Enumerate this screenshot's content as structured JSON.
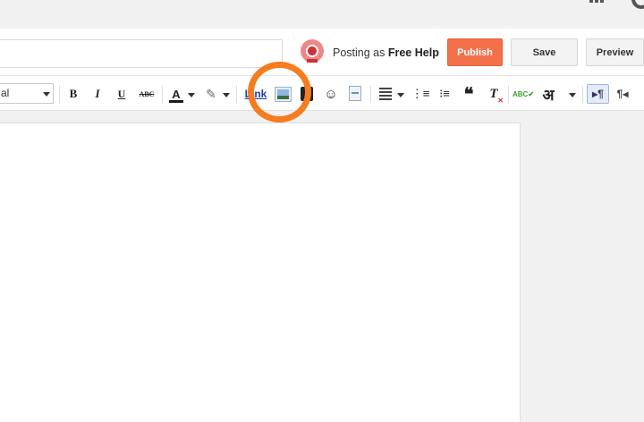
{
  "header": {
    "posting_as_prefix": "Posting as",
    "posting_as_name": "Free Help",
    "publish_label": "Publish",
    "save_label": "Save",
    "preview_label": "Preview"
  },
  "toolbar": {
    "font_value": "al",
    "bold": "B",
    "italic": "I",
    "underline": "U",
    "strike": "ABC",
    "text_color": "A",
    "link": "Link",
    "emoji": "☺",
    "ordered_list": "⋮≡",
    "bullet_list": "⁝≡",
    "quote": "❝",
    "clear_format": "T",
    "spellcheck": "ABC✔",
    "transliterate": "अ",
    "ltr": "▸¶",
    "rtl": "¶◂"
  },
  "colors": {
    "publish": "#f2704a",
    "highlight_ring": "#f57c1f",
    "link": "#1a3fb3"
  },
  "icons": [
    "apps-grid-icon",
    "account-avatar-icon",
    "blog-avatar-icon",
    "text-color-icon",
    "highlight-color-icon",
    "insert-image-icon",
    "insert-video-icon",
    "emoji-icon",
    "jump-break-icon",
    "align-icon",
    "ordered-list-icon",
    "bullet-list-icon",
    "quote-icon",
    "clear-format-icon",
    "spellcheck-icon",
    "transliterate-icon",
    "ltr-icon",
    "rtl-icon"
  ]
}
